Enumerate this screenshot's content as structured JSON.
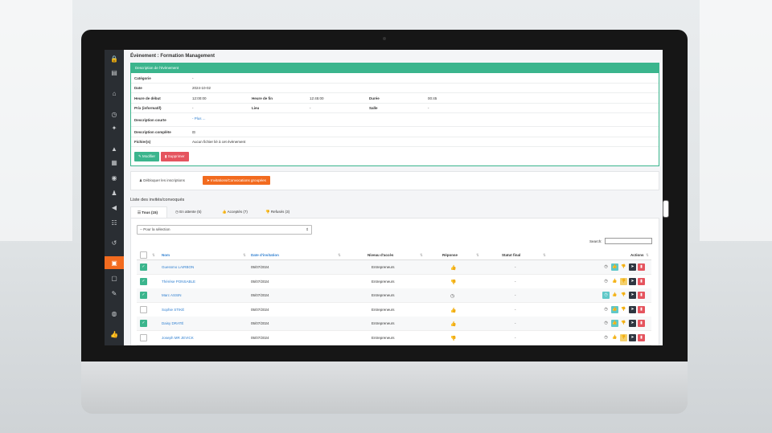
{
  "page_title": "Évènement : Formation Management",
  "panel_header": "Description de l'évènement",
  "details": {
    "categorie_label": "Catégorie",
    "categorie_value": "-",
    "date_label": "Date",
    "date_value": "2024-10-02",
    "debut_label": "Heure de début",
    "debut_value": "12:00:00",
    "fin_label": "Heure de fin",
    "fin_value": "12:45:00",
    "duree_label": "Durée",
    "duree_value": "00:45",
    "prix_label": "Prix (informatif)",
    "prix_value": "-",
    "lieu_label": "Lieu",
    "lieu_value": "-",
    "salle_label": "Salle",
    "salle_value": "-",
    "courte_label": "Description courte",
    "courte_value": "- Plus ...",
    "complete_label": "Description complète",
    "complete_value": "⊟",
    "fichiers_label": "Fichier(s)",
    "fichiers_value": "Aucun fichier lié à cet évènement"
  },
  "buttons": {
    "modifier": "Modifier",
    "supprimer": "Supprimer"
  },
  "toolbar": {
    "unblock": "Débloquer les inscriptions",
    "invite": "Invitations/Convocations groupées"
  },
  "list_title": "Liste des invités/convoqués",
  "tabs": [
    {
      "label": "Tous (15)"
    },
    {
      "label": "En attente (5)"
    },
    {
      "label": "Acceptés (7)"
    },
    {
      "label": "Refusés (3)"
    }
  ],
  "bulk_select": "-- Pour la sélection",
  "search_label": "Search:",
  "table": {
    "headers": {
      "nom": "Nom",
      "date": "Date d'invitation",
      "niveau": "Niveau d'accès",
      "reponse": "Réponse",
      "statut": "Statut final",
      "actions": "Actions"
    },
    "rows": [
      {
        "checked": true,
        "nom": "Guessmo LAIRBON",
        "date": "05/07/2024",
        "niveau": "Entrepreneurs",
        "reponse": "accepted",
        "statut": "-"
      },
      {
        "checked": true,
        "nom": "Thérèse PONSABLE",
        "date": "05/07/2024",
        "niveau": "Entrepreneurs",
        "reponse": "refused",
        "statut": "-"
      },
      {
        "checked": true,
        "nom": "Marc ASSIN",
        "date": "05/07/2024",
        "niveau": "Entrepreneurs",
        "reponse": "pending",
        "statut": "-"
      },
      {
        "checked": false,
        "nom": "Sophie STIKÉ",
        "date": "05/07/2024",
        "niveau": "Entrepreneurs",
        "reponse": "accepted",
        "statut": "-"
      },
      {
        "checked": true,
        "nom": "Daisy DRATÉ",
        "date": "05/07/2024",
        "niveau": "Entrepreneurs",
        "reponse": "accepted",
        "statut": "-"
      },
      {
        "checked": false,
        "nom": "Joseph MR JEVICK",
        "date": "05/07/2024",
        "niveau": "Entrepreneurs",
        "reponse": "refused",
        "statut": "-"
      }
    ]
  },
  "colors": {
    "accent": "#3bb58d",
    "orange": "#f26b1f",
    "danger": "#e5545e",
    "sidebar": "#2a2e33"
  }
}
